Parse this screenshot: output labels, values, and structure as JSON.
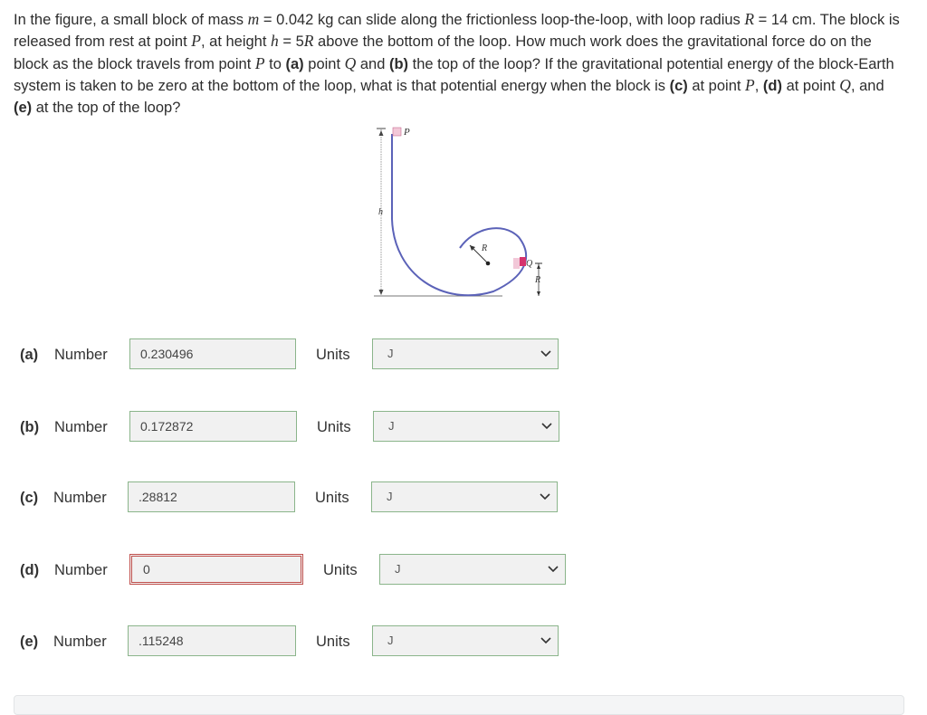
{
  "question": {
    "t1": "In the figure, a small block of mass ",
    "v_m": "m",
    "t2": " = 0.042 kg can slide along the frictionless loop-the-loop, with loop radius ",
    "v_R": "R",
    "t3": " = 14 cm. The block is released from rest at point ",
    "v_P": "P",
    "t4": ", at height ",
    "v_h": "h",
    "t5": " = 5",
    "v_R2": "R",
    "t6": " above the bottom of the loop. How much work does the gravitational force do on the block as the block travels from point ",
    "v_P2": "P",
    "t7": " to ",
    "b_a": "(a)",
    "t8": " point ",
    "v_Q": "Q",
    "t9": " and ",
    "b_b": "(b)",
    "t10": " the top of the loop? If the gravitational potential energy of the block-Earth system is taken to be zero at the bottom of the loop, what is that potential energy when the block is ",
    "b_c": "(c)",
    "t11": " at point ",
    "v_P3": "P",
    "t12": ", ",
    "b_d": "(d)",
    "t13": " at point ",
    "v_Q2": "Q",
    "t14": ", and ",
    "b_e": "(e)",
    "t15": " at the top of the loop?"
  },
  "figure": {
    "label_P": "P",
    "label_h": "h",
    "label_R_top": "R",
    "label_Q": "Q",
    "label_R_side": "R",
    "colors": {
      "track": "#5b62b8",
      "block": "#d6336c",
      "block_light": "#f2c8d8"
    }
  },
  "answers": [
    {
      "part": "(a)",
      "number_label": "Number",
      "value": "0.230496",
      "units_label": "Units",
      "unit": "J",
      "state": "normal"
    },
    {
      "part": "(b)",
      "number_label": "Number",
      "value": "0.172872",
      "units_label": "Units",
      "unit": "J",
      "state": "normal"
    },
    {
      "part": "(c)",
      "number_label": "Number",
      "value": ".28812",
      "units_label": "Units",
      "unit": "J",
      "state": "normal"
    },
    {
      "part": "(d)",
      "number_label": "Number",
      "value": "0",
      "units_label": "Units",
      "unit": "J",
      "state": "error"
    },
    {
      "part": "(e)",
      "number_label": "Number",
      "value": ".115248",
      "units_label": "Units",
      "unit": "J",
      "state": "normal"
    }
  ]
}
